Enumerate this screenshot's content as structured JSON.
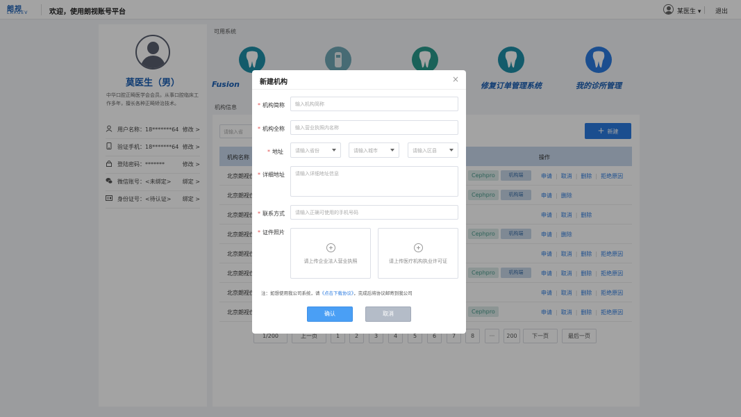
{
  "header": {
    "logo_cn": "朗视",
    "logo_en": "LARGEV",
    "title": "欢迎，使用朗视账号平台",
    "user": "某医生",
    "user_caret": "▾",
    "logout": "退出"
  },
  "profile": {
    "name": "莫医生（男）",
    "description": "中华口腔正畸医学会会员。从事口腔临床工作多年，擅长各种正畸矫治技术。",
    "rows": [
      {
        "icon": "user-icon",
        "label": "用户名称：18*******64",
        "action": "修改 >"
      },
      {
        "icon": "phone-icon",
        "label": "验证手机：18*******64",
        "action": "修改 >"
      },
      {
        "icon": "lock-icon",
        "label": "登陆密码：*******",
        "action": "修改 >"
      },
      {
        "icon": "wechat-icon",
        "label": "微信账号：<未绑定>",
        "action": "绑定 >"
      },
      {
        "icon": "id-card-icon",
        "label": "身份证号：<待认证>",
        "action": "绑定 >"
      }
    ]
  },
  "systems": {
    "section_label": "可用系统",
    "items": [
      {
        "name": "Fusion",
        "color": "#1e8fa8"
      },
      {
        "name": "",
        "color": "#6fa8b6"
      },
      {
        "name": "",
        "color": "#2a9a8c"
      },
      {
        "name": "修复订单管理系统",
        "color": "#1e8fa8"
      },
      {
        "name": "我的诊所管理",
        "color": "#2b7be0"
      }
    ]
  },
  "orgs": {
    "section_label": "机构信息",
    "search_placeholder": "请输入省",
    "new_button": "新建",
    "col_name": "机构名称",
    "col_actions": "操作",
    "tag_cephpro": "Cephpro",
    "tag_machine": "机构端",
    "rows": [
      {
        "name": "北京朗视仪",
        "cephpro": true,
        "machine": true,
        "actions": [
          "申请",
          "取消",
          "删除",
          "拒绝原因"
        ]
      },
      {
        "name": "北京朗视仪",
        "cephpro": true,
        "machine": true,
        "actions": [
          "申请",
          "删除"
        ]
      },
      {
        "name": "北京朗视仪",
        "cephpro": false,
        "machine": false,
        "actions": [
          "申请",
          "取消",
          "删除"
        ]
      },
      {
        "name": "北京朗视仪",
        "cephpro": true,
        "machine": true,
        "actions": [
          "申请",
          "删除"
        ]
      },
      {
        "name": "北京朗视仪",
        "cephpro": false,
        "machine": false,
        "actions": [
          "申请",
          "取消",
          "删除",
          "拒绝原因"
        ]
      },
      {
        "name": "北京朗视仪",
        "cephpro": true,
        "machine": true,
        "actions": [
          "申请",
          "取消",
          "删除",
          "拒绝原因"
        ]
      },
      {
        "name": "北京朗视仪",
        "cephpro": false,
        "machine": false,
        "actions": [
          "申请",
          "取消",
          "删除",
          "拒绝原因"
        ]
      },
      {
        "name": "北京朗视仪",
        "cephpro": true,
        "machine": false,
        "actions": [
          "申请",
          "取消",
          "删除",
          "拒绝原因"
        ]
      }
    ]
  },
  "pagination": {
    "current": "1/200",
    "prev": "上一页",
    "pages": [
      "1",
      "2",
      "3",
      "4",
      "5",
      "6",
      "7",
      "8",
      "···",
      "200"
    ],
    "next": "下一页",
    "last": "最后一页"
  },
  "dialog": {
    "title": "新建机构",
    "close": "×",
    "fields": {
      "short_name": {
        "label": "机构简称",
        "placeholder": "输入机构简称"
      },
      "full_name": {
        "label": "机构全称",
        "placeholder": "输入营业执照内名称"
      },
      "address": {
        "label": "地址",
        "province": "请输入省份",
        "city": "请输入城市",
        "district": "请输入区县"
      },
      "detail": {
        "label": "详细地址",
        "placeholder": "请输入详细地址信息"
      },
      "contact": {
        "label": "联系方式",
        "placeholder": "请输入正确可使用的手机号码"
      },
      "photos": {
        "label": "证件照片",
        "upload1": "请上传企业法人营业执照",
        "upload2": "请上传医疗机构执业许可证"
      }
    },
    "note_prefix": "注：如想使用我公司系统，请",
    "note_link": "《点击下载协议》",
    "note_suffix": "，完成后将协议邮寄到我公司",
    "confirm": "确认",
    "cancel": "取消"
  }
}
